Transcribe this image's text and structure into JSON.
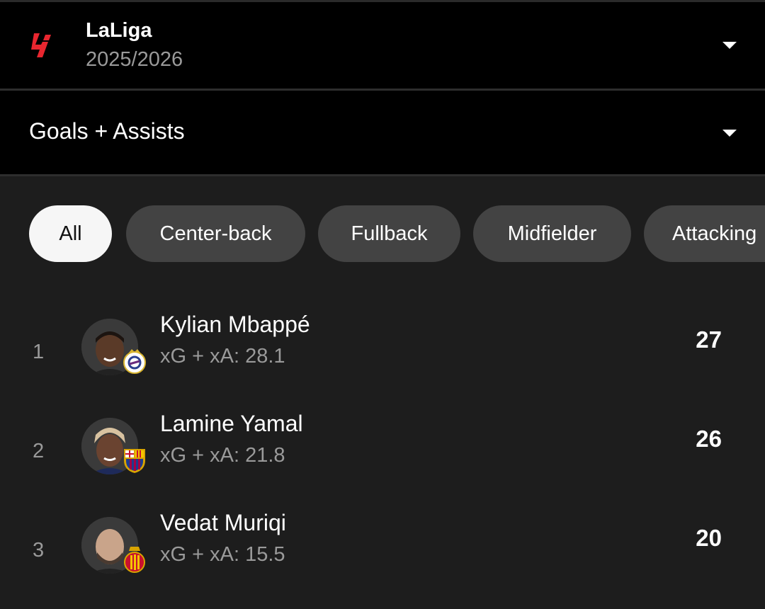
{
  "league": {
    "name": "LaLiga",
    "season": "2025/2026",
    "logo_icon": "laliga-logo-icon",
    "logo_color": "#e8262f"
  },
  "stat": {
    "label": "Goals + Assists"
  },
  "filters": [
    {
      "label": "All",
      "active": true
    },
    {
      "label": "Center-back",
      "active": false
    },
    {
      "label": "Fullback",
      "active": false
    },
    {
      "label": "Midfielder",
      "active": false
    },
    {
      "label": "Attacking",
      "active": false
    }
  ],
  "players": [
    {
      "rank": "1",
      "name": "Kylian Mbappé",
      "meta": "xG + xA: 28.1",
      "value": "27",
      "club_icon": "real-madrid-badge-icon"
    },
    {
      "rank": "2",
      "name": "Lamine Yamal",
      "meta": "xG + xA: 21.8",
      "value": "26",
      "club_icon": "barcelona-badge-icon"
    },
    {
      "rank": "3",
      "name": "Vedat Muriqi",
      "meta": "xG + xA: 15.5",
      "value": "20",
      "club_icon": "mallorca-badge-icon"
    }
  ],
  "colors": {
    "background": "#1d1d1d",
    "header_bg": "#000000",
    "chip_bg": "#434343",
    "chip_active_bg": "#f6f6f6",
    "muted_text": "#9a9a9a"
  }
}
